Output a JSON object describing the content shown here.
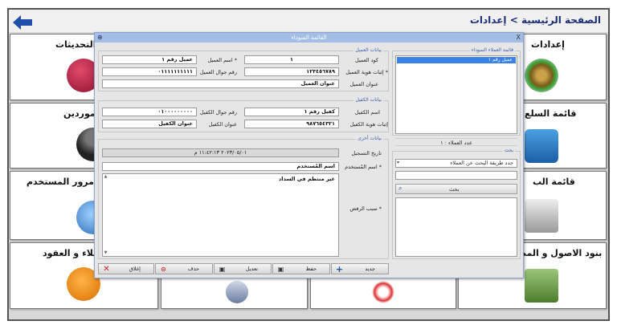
{
  "header": {
    "breadcrumb": "الصفحة الرئيسية > إعدادات"
  },
  "tiles": [
    {
      "label": "إعدادات"
    },
    {
      "label": "ن التحديثات"
    },
    {
      "label": "قائمة السلع"
    },
    {
      "label": "الموردين"
    },
    {
      "label": "قائمة الب"
    },
    {
      "label": "كلمة مرور المستخدم"
    },
    {
      "label": "بنود الاصول و المصرو"
    },
    {
      "label": "العملاء و العقود"
    }
  ],
  "dialog": {
    "title": "القائمة السوداء",
    "close": "X",
    "pin": "⊕",
    "blacklist": {
      "title": "قائمة العملاء السوداء",
      "items": [
        "عميل رقم ١"
      ],
      "count_label": "عدد العملاء : ١"
    },
    "search": {
      "title": "بحث",
      "placeholder": "حدد طريقة البحث عن العملاء",
      "button": "بحث"
    },
    "client": {
      "title": "بيانات العميل",
      "code_label": "كود العميل",
      "code": "١",
      "name_label": "* اسم العميل",
      "name": "عميل رقم ١",
      "id_label": "* إثبات هوية العميل",
      "id": "١٢٣٤٥٦٧٨٩",
      "mobile_label": "رقم جوال العميل",
      "mobile": "٠١١١١١١١١١١",
      "address_label": "عنوان العميل",
      "address": "عنوان العميل"
    },
    "guarantor": {
      "title": "بيانات الكفيل",
      "name_label": "اسم الكفيل",
      "name": "كفيل رقم ١",
      "mobile_label": "رقم جوال الكفيل",
      "mobile": "٠١٠٠٠٠٠٠٠٠٠",
      "id_label": "إثبات هوية الكفيل",
      "id": "٩٨٧٦٥٤٣٢١",
      "address_label": "عنوان الكفيل",
      "address": "عنوان الكفيل"
    },
    "other": {
      "title": "بيانات أخرى",
      "date_label": "تاريخ التسجيل",
      "date": "٢٠٢٣/٠٥/٠١ ١١:٤٢:١٣ م",
      "user_label": "* اسم المُستخدم",
      "user": "اسم المُستخدم",
      "reason_label": "* سبب الرفض",
      "reason": "غير منتظم في السداد"
    },
    "buttons": {
      "new": "جديد",
      "save": "حفظ",
      "edit": "تعديل",
      "delete": "حذف",
      "close": "إغلاق"
    }
  },
  "colors": {
    "accent": "#1f4fa8",
    "title_bar": "#a4bde6",
    "frame": "#555555"
  }
}
